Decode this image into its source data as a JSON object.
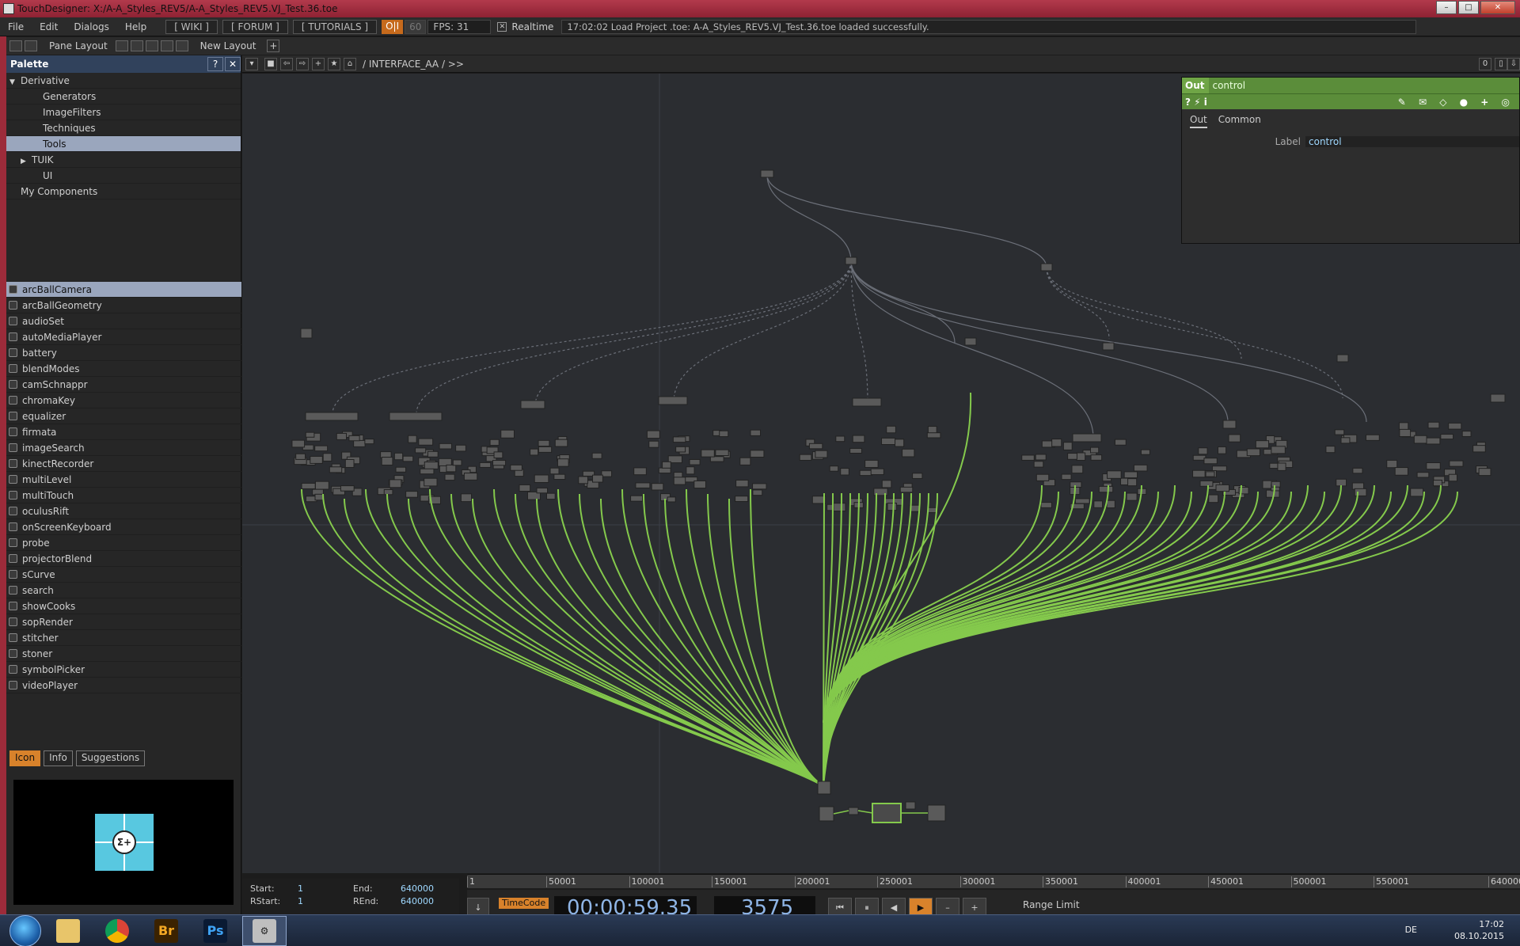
{
  "window": {
    "title": "TouchDesigner: X:/A-A_Styles_REV5/A-A_Styles_REV5.VJ_Test.36.toe",
    "buttons": [
      "–",
      "□",
      "✕"
    ]
  },
  "menubar": {
    "items": [
      "File",
      "Edit",
      "Dialogs",
      "Help"
    ],
    "wiki": "[ WIKI ]",
    "forum": "[ FORUM ]",
    "tutorials": "[ TUTORIALS ]",
    "oi": "O|I",
    "sixty": "60",
    "fps": "FPS:  31",
    "realtime_check": "✕",
    "realtime": "Realtime",
    "status": "17:02:02 Load Project .toe: A-A_Styles_REV5.VJ_Test.36.toe loaded successfully."
  },
  "toolbar2": {
    "pane_layout": "Pane Layout",
    "new_layout": "New Layout",
    "plus": "+"
  },
  "palette": {
    "title": "Palette",
    "help": "?",
    "close": "✕",
    "tree": [
      {
        "label": "Derivative",
        "indent": 0,
        "arrow": "▼",
        "selected": false
      },
      {
        "label": "Generators",
        "indent": 2,
        "arrow": "",
        "selected": false
      },
      {
        "label": "ImageFilters",
        "indent": 2,
        "arrow": "",
        "selected": false
      },
      {
        "label": "Techniques",
        "indent": 2,
        "arrow": "",
        "selected": false
      },
      {
        "label": "Tools",
        "indent": 2,
        "arrow": "",
        "selected": true
      },
      {
        "label": "TUIK",
        "indent": 1,
        "arrow": "▶",
        "selected": false
      },
      {
        "label": "UI",
        "indent": 2,
        "arrow": "",
        "selected": false
      },
      {
        "label": "My Components",
        "indent": 0,
        "arrow": "",
        "selected": false
      }
    ],
    "components": [
      "arcBallCamera",
      "arcBallGeometry",
      "audioSet",
      "autoMediaPlayer",
      "battery",
      "blendModes",
      "camSchnappr",
      "chromaKey",
      "equalizer",
      "firmata",
      "imageSearch",
      "kinectRecorder",
      "multiLevel",
      "multiTouch",
      "oculusRift",
      "onScreenKeyboard",
      "probe",
      "projectorBlend",
      "sCurve",
      "search",
      "showCooks",
      "sopRender",
      "stitcher",
      "stoner",
      "symbolPicker",
      "videoPlayer"
    ],
    "selected_component": "arcBallCamera",
    "tabs": [
      "Icon",
      "Info",
      "Suggestions"
    ],
    "active_tab": "Icon",
    "preview_glyph": "Σ+"
  },
  "network": {
    "path": "/ INTERFACE_AA / >>",
    "zero": "0"
  },
  "params": {
    "op_type": "Out",
    "op_name": "control",
    "icons": "?  ⚡  i",
    "tabs": [
      "Out",
      "Common"
    ],
    "label_param": "Label",
    "label_value": "control"
  },
  "timeline": {
    "ticks": [
      "1",
      "50001",
      "100001",
      "150001",
      "200001",
      "250001",
      "300001",
      "350001",
      "400001",
      "450001",
      "500001",
      "550001",
      "640000"
    ],
    "start_label": "Start:",
    "start_value": "1",
    "end_label": "End:",
    "end_value": "640000",
    "rstart_label": "RStart:",
    "rstart_value": "1",
    "rend_label": "REnd:",
    "rend_value": "640000",
    "timecode_label": "TimeCode",
    "timecode": "00:00:59.35",
    "frame": "3575",
    "range_limit": "Range Limit"
  },
  "taskbar": {
    "apps": [
      "folder",
      "chrome",
      "Br",
      "Ps",
      "TD"
    ],
    "lang": "DE",
    "time": "17:02",
    "date": "08.10.2015"
  },
  "colors": {
    "wire": "#84c94c",
    "accent_orange": "#d8822b",
    "palette_header": "#31425c",
    "param_green": "#6fa546"
  }
}
